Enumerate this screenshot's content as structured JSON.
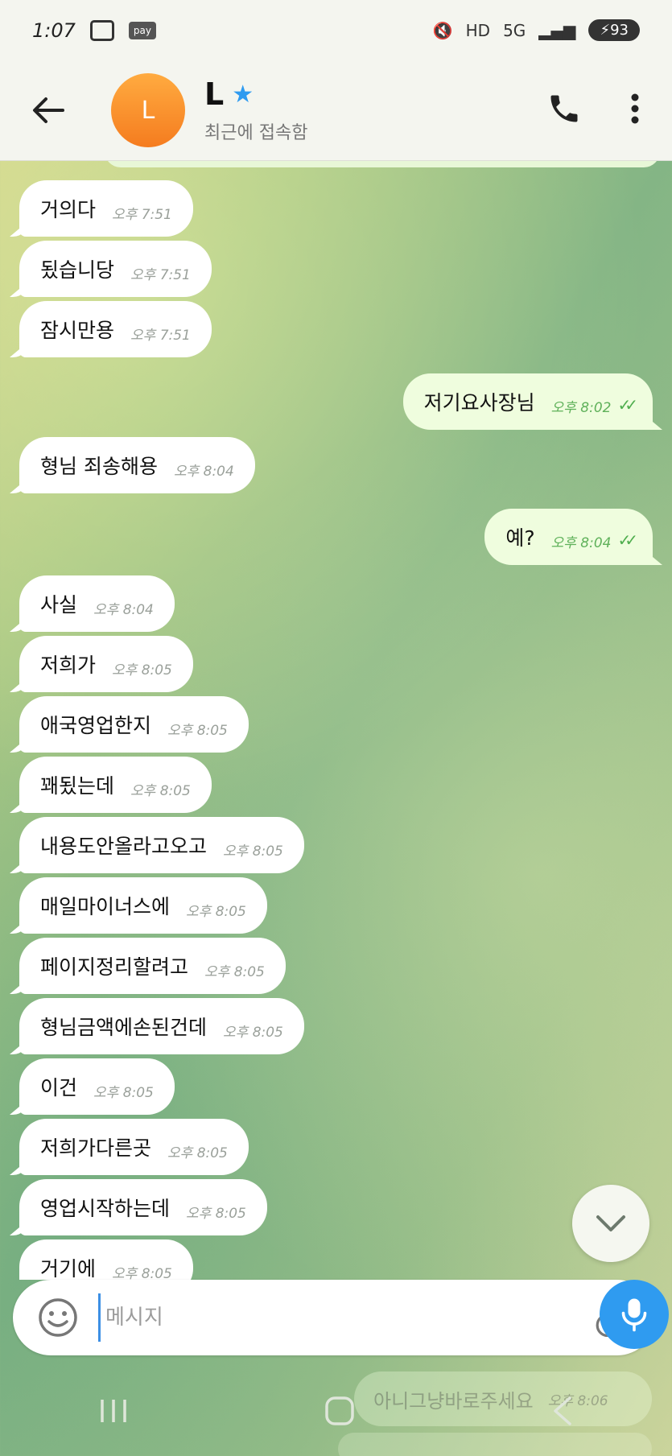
{
  "status_bar": {
    "time": "1:07",
    "pay_label": "pay",
    "battery": "93"
  },
  "header": {
    "avatar_letter": "L",
    "contact_name": "L",
    "contact_status": "최근에 접속함"
  },
  "messages": [
    {
      "side": "in",
      "text": "거의다",
      "time": "오후 7:51"
    },
    {
      "side": "in",
      "text": "됬습니당",
      "time": "오후 7:51"
    },
    {
      "side": "in",
      "text": "잠시만용",
      "time": "오후 7:51"
    },
    {
      "side": "out",
      "text": "저기요사장님",
      "time": "오후 8:02",
      "ticks": "✓✓"
    },
    {
      "side": "in",
      "text": "형님 죄송해용",
      "time": "오후 8:04"
    },
    {
      "side": "out",
      "text": "예?",
      "time": "오후 8:04",
      "ticks": "✓✓"
    },
    {
      "side": "in",
      "text": "사실",
      "time": "오후 8:04"
    },
    {
      "side": "in",
      "text": "저희가",
      "time": "오후 8:05"
    },
    {
      "side": "in",
      "text": "애국영업한지",
      "time": "오후 8:05"
    },
    {
      "side": "in",
      "text": "꽤됬는데",
      "time": "오후 8:05"
    },
    {
      "side": "in",
      "text": "내용도안올라고오고",
      "time": "오후 8:05"
    },
    {
      "side": "in",
      "text": "매일마이너스에",
      "time": "오후 8:05"
    },
    {
      "side": "in",
      "text": "페이지정리할려고",
      "time": "오후 8:05"
    },
    {
      "side": "in",
      "text": "형님금액에손된건데",
      "time": "오후 8:05"
    },
    {
      "side": "in",
      "text": "이건",
      "time": "오후 8:05"
    },
    {
      "side": "in",
      "text": "저희가다른곳",
      "time": "오후 8:05"
    },
    {
      "side": "in",
      "text": "영업시작하는데",
      "time": "오후 8:05"
    },
    {
      "side": "in",
      "text": "거기에",
      "time": "오후 8:05"
    }
  ],
  "composer": {
    "placeholder": "메시지"
  },
  "behind_nav": {
    "text": "아니그냥바로주세요",
    "time": "오후 8:06"
  },
  "colors": {
    "accent": "#2f9bf0",
    "avatar": "#f57c1f",
    "outgoing_bubble": "#effdde",
    "incoming_bubble": "#ffffff",
    "read_ticks": "#4fae4e"
  }
}
